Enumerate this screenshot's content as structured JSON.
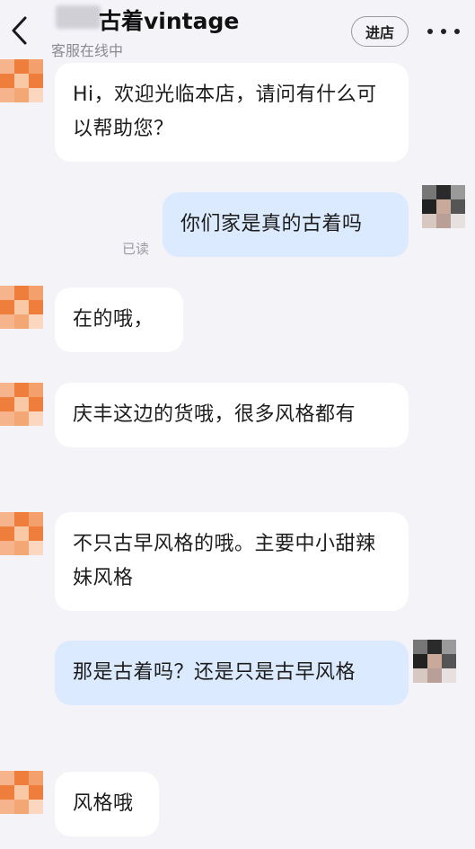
{
  "header": {
    "title": "古着vintage",
    "status": "客服在线中",
    "enter_store_label": "进店",
    "icons": {
      "back": "chevron-left-icon",
      "more": "more-horizontal-icon"
    }
  },
  "colors": {
    "background": "#f3f3f8",
    "bubble_received": "#ffffff",
    "bubble_sent": "#dbeafe",
    "shop_avatar": "#ef7d3b"
  },
  "messages": [
    {
      "from": "shop",
      "text": "Hi，欢迎光临本店，请问有什么可以帮助您？"
    },
    {
      "from": "me",
      "text": "你们家是真的古着吗",
      "read_status": "已读"
    },
    {
      "from": "shop",
      "text": "在的哦，"
    },
    {
      "from": "shop",
      "text": "庆丰这边的货哦，很多风格都有"
    },
    {
      "from": "shop",
      "text": "不只古早风格的哦。主要中小甜辣妹风格"
    },
    {
      "from": "me",
      "text": "那是古着吗？还是只是古早风格"
    },
    {
      "from": "shop",
      "text": "风格哦"
    }
  ]
}
